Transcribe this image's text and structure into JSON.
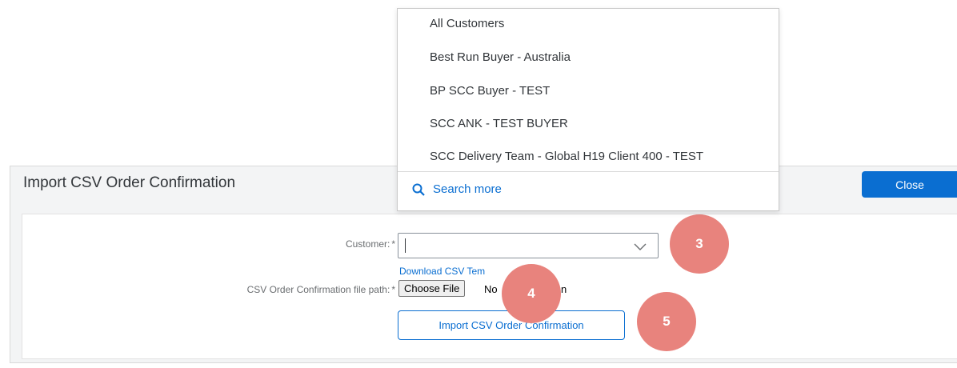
{
  "dialog": {
    "title": "Import CSV Order Confirmation",
    "close_label": "Close"
  },
  "form": {
    "customer_label": "Customer:",
    "required_mark": "*",
    "customer_value": "",
    "download_link": "Download CSV Tem",
    "file_path_label": "CSV Order Confirmation file path:",
    "choose_file_label": "Choose File",
    "file_status": "No",
    "file_status_tail": "n",
    "import_button": "Import CSV Order Confirmation"
  },
  "dropdown": {
    "items": [
      "All Customers",
      "Best Run Buyer - Australia",
      "BP SCC Buyer - TEST",
      "SCC ANK - TEST BUYER",
      "SCC Delivery Team - Global H19 Client 400 - TEST"
    ],
    "search_more": "Search more"
  },
  "badges": [
    "3",
    "4",
    "5"
  ],
  "colors": {
    "accent": "#0a6ed1",
    "badge": "#e8837d"
  }
}
